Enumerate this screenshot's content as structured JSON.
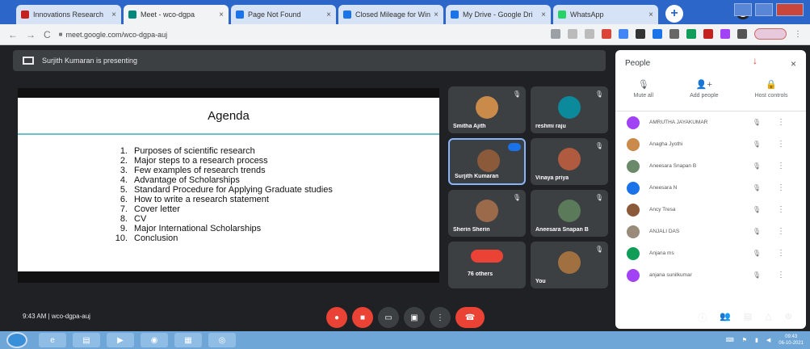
{
  "browser": {
    "tabs": [
      {
        "label": "Innovations Research",
        "color": "#c5221f",
        "active": false
      },
      {
        "label": "Meet - wco-dgpa",
        "color": "#00897b",
        "active": true
      },
      {
        "label": "Page Not Found",
        "color": "#1a73e8",
        "active": false
      },
      {
        "label": "Closed Mileage for Win",
        "color": "#1a73e8",
        "active": false
      },
      {
        "label": "My Drive - Google Dri",
        "color": "#1a73e8",
        "active": false
      },
      {
        "label": "WhatsApp",
        "color": "#25d366",
        "active": false
      }
    ],
    "new_tab_label": "+",
    "back": "←",
    "forward": "→",
    "reload": "C",
    "url": "meet.google.com/wco-dgpa-auj"
  },
  "meet": {
    "presenting_text": "Surjith Kumaran is presenting",
    "slide": {
      "title": "Agenda",
      "items": [
        {
          "num": "1.",
          "text": "Purposes of scientific research"
        },
        {
          "num": "2.",
          "text": "Major steps to a research process"
        },
        {
          "num": "3.",
          "text": "Few examples of research trends"
        },
        {
          "num": "4.",
          "text": "Advantage of Scholarships"
        },
        {
          "num": "5.",
          "text": "Standard Procedure for Applying Graduate studies"
        },
        {
          "num": "6.",
          "text": "How to write a research statement"
        },
        {
          "num": "7.",
          "text": "Cover letter"
        },
        {
          "num": "8.",
          "text": "CV"
        },
        {
          "num": "9.",
          "text": "Major International Scholarships"
        },
        {
          "num": "10.",
          "text": "Conclusion"
        }
      ]
    },
    "tiles": [
      {
        "name": "Smitha Ajith",
        "color": "#c98a4a"
      },
      {
        "name": "reshmi raju",
        "color": "#0b8a9b"
      },
      {
        "name": "Surjith Kumaran",
        "color": "#8a5a3a"
      },
      {
        "name": "Vinaya priya",
        "color": "#b05a40"
      },
      {
        "name": "Sherin Sherin",
        "color": "#9a6a4a"
      },
      {
        "name": "Aneesara Snapan B",
        "color": "#5a7a5a"
      },
      {
        "name": "76 others",
        "color": "#3c4043"
      },
      {
        "name": "You",
        "color": "#a07040"
      }
    ],
    "meeting_time": "9:43 AM",
    "meeting_code": "wco-dgpa-auj",
    "separator": "|"
  },
  "people_panel": {
    "title": "People",
    "close": "×",
    "actions": [
      {
        "label": "Mute all",
        "icon": "🎙"
      },
      {
        "label": "Add people",
        "icon": "👤+"
      },
      {
        "label": "Host controls",
        "icon": "🔒"
      }
    ],
    "participants": [
      {
        "name": "AMRUTHA JAYAKUMAR",
        "color": "#a142f4"
      },
      {
        "name": "Anagha Jyothi",
        "color": "#c98a4a"
      },
      {
        "name": "Aneesara Snapan B",
        "color": "#6a8a6a"
      },
      {
        "name": "Aneesara N",
        "color": "#1a73e8"
      },
      {
        "name": "Ancy Tresa",
        "color": "#8a5a3a"
      },
      {
        "name": "ANJALI DAS",
        "color": "#9a8a7a"
      },
      {
        "name": "Anjana ms",
        "color": "#0f9d58"
      },
      {
        "name": "anjana sunilkumar",
        "color": "#a142f4"
      }
    ],
    "mic_icon": "🎙",
    "more_icon": "⋮"
  },
  "taskbar": {
    "clock_time": "09:43",
    "clock_date": "06-10-2021"
  }
}
